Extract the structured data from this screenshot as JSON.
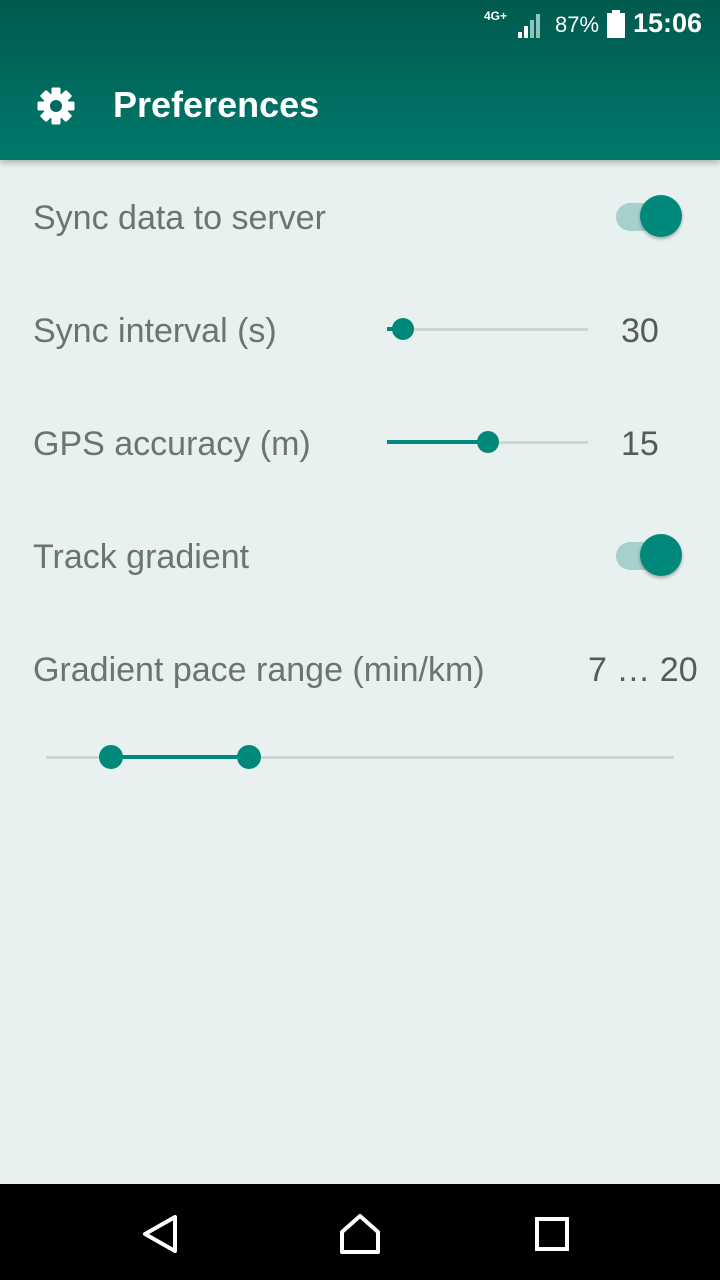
{
  "status_bar": {
    "network": "4G+",
    "battery_percent": "87%",
    "time": "15:06",
    "icons": [
      "signal-icon",
      "battery-icon"
    ]
  },
  "app_bar": {
    "title": "Preferences",
    "icon": "gear-icon"
  },
  "preferences": {
    "sync_data": {
      "label": "Sync data to server",
      "enabled": true
    },
    "sync_interval": {
      "label": "Sync interval (s)",
      "value": "30",
      "fraction": 0.08
    },
    "gps_accuracy": {
      "label": "GPS accuracy (m)",
      "value": "15",
      "fraction": 0.5
    },
    "track_gradient": {
      "label": "Track gradient",
      "enabled": true
    },
    "gradient_pace_range": {
      "label": "Gradient pace range (min/km)",
      "value": "7 … 20",
      "low_fraction": 0.104,
      "high_fraction": 0.323
    }
  },
  "nav_bar": {
    "icons": [
      "back-icon",
      "home-icon",
      "recents-icon"
    ]
  },
  "colors": {
    "accent": "#00897b",
    "app_bar_dark": "#005a4e",
    "app_bar": "#00796b",
    "background": "#e8f0f0",
    "switch_track": "#a6d0cb"
  }
}
